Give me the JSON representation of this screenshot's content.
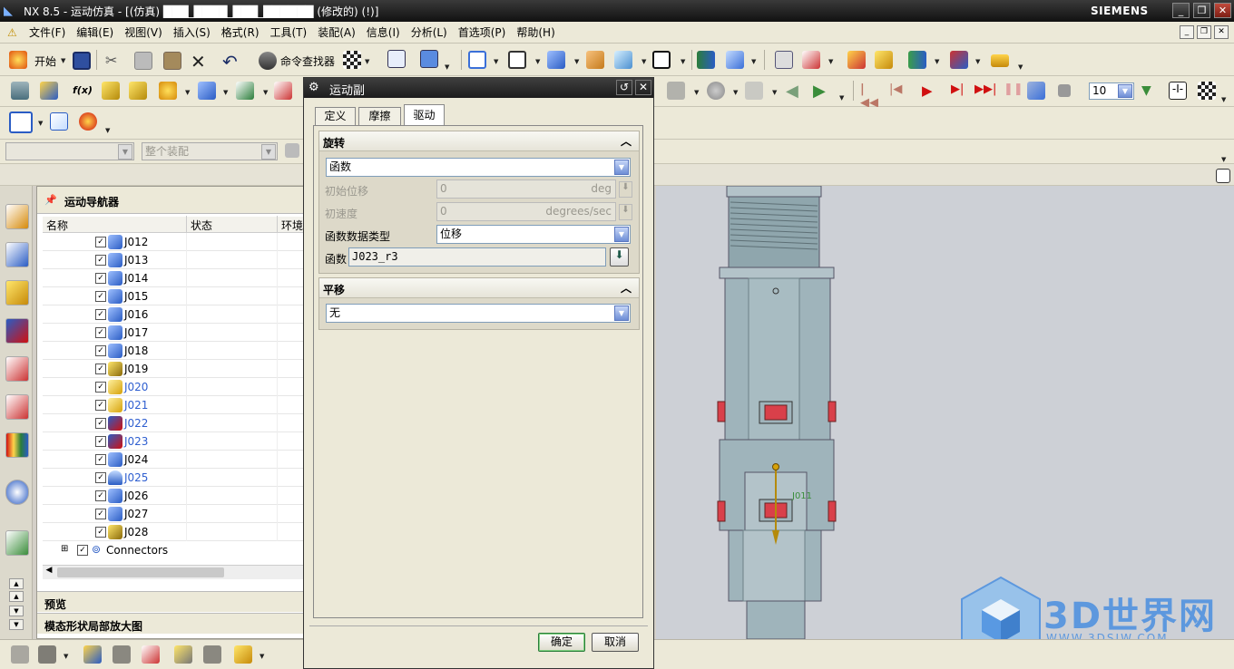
{
  "window": {
    "title": "NX 8.5 - 运动仿真 - [(仿真) ███_████_███_██████ (修改的)      (!)]",
    "brand": "SIEMENS",
    "controls": [
      "_",
      "❐",
      "✕"
    ]
  },
  "menu": {
    "items": [
      "文件(F)",
      "编辑(E)",
      "视图(V)",
      "插入(S)",
      "格式(R)",
      "工具(T)",
      "装配(A)",
      "信息(I)",
      "分析(L)",
      "首选项(P)",
      "帮助(H)"
    ]
  },
  "toolbar": {
    "start_label": "开始",
    "command_finder_label": "命令查找器",
    "playback_step_value": "10"
  },
  "selection_bar": {
    "filter_value": "",
    "scope_value": "整个装配"
  },
  "navigator": {
    "title": "运动导航器",
    "columns": [
      "名称",
      "状态",
      "环境"
    ],
    "rows": [
      {
        "name": "J012",
        "icon": "joint-icon",
        "highlight": false
      },
      {
        "name": "J013",
        "icon": "joint-icon",
        "highlight": false
      },
      {
        "name": "J014",
        "icon": "joint-icon",
        "highlight": false
      },
      {
        "name": "J015",
        "icon": "joint-icon",
        "highlight": false
      },
      {
        "name": "J016",
        "icon": "joint-icon",
        "highlight": false
      },
      {
        "name": "J017",
        "icon": "joint-icon",
        "highlight": false
      },
      {
        "name": "J018",
        "icon": "joint-icon",
        "highlight": false
      },
      {
        "name": "J019",
        "icon": "screw-joint-icon",
        "highlight": false
      },
      {
        "name": "J020",
        "icon": "gear-joint-icon",
        "highlight": true
      },
      {
        "name": "J021",
        "icon": "gear-joint-icon",
        "highlight": true
      },
      {
        "name": "J022",
        "icon": "motion-driver-icon",
        "highlight": true
      },
      {
        "name": "J023",
        "icon": "motion-driver-icon",
        "highlight": true
      },
      {
        "name": "J024",
        "icon": "joint-icon",
        "highlight": false
      },
      {
        "name": "J025",
        "icon": "screw-icon",
        "highlight": true
      },
      {
        "name": "J026",
        "icon": "joint-icon",
        "highlight": false
      },
      {
        "name": "J027",
        "icon": "joint-icon",
        "highlight": false
      },
      {
        "name": "J028",
        "icon": "screw-joint-icon",
        "highlight": false
      }
    ],
    "connectors_label": "Connectors",
    "preview_label": "预览",
    "detail_label": "模态形状局部放大图"
  },
  "dialog": {
    "title": "运动副",
    "tabs": [
      "定义",
      "摩擦",
      "驱动"
    ],
    "active_tab": "驱动",
    "rotation_section": {
      "title": "旋转",
      "mode_value": "函数",
      "initial_displacement_label": "初始位移",
      "initial_displacement_value": "0",
      "initial_displacement_unit": "deg",
      "initial_velocity_label": "初速度",
      "initial_velocity_value": "0",
      "initial_velocity_unit": "degrees/sec",
      "function_data_type_label": "函数数据类型",
      "function_data_type_value": "位移",
      "function_label": "函数",
      "function_value": "J023_r3"
    },
    "translation_section": {
      "title": "平移",
      "mode_value": "无"
    },
    "ok_label": "确定",
    "cancel_label": "取消"
  },
  "viewport": {
    "model_label": "J011",
    "watermark_text": "3D世界网",
    "watermark_url": "WWW.3DSJW.COM"
  },
  "colors": {
    "accent_blue": "#3a6fd8",
    "highlight_text": "#2f5fd0",
    "model_body": "#9fb4bb",
    "model_red": "#d9404a",
    "watermark": "#4a8fe0"
  }
}
